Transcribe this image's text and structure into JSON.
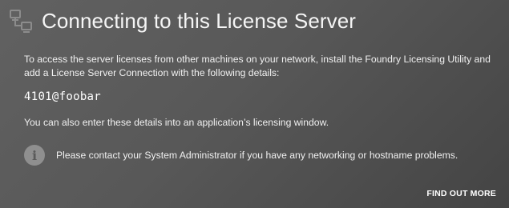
{
  "header": {
    "icon": "network-computers-icon",
    "title": "Connecting to this License Server"
  },
  "body": {
    "intro": "To access the server licenses from other machines on your network, install the Foundry Licensing Utility and add a License Server Connection with the following details:",
    "server_address": "4101@foobar",
    "also_text": "You can also enter these details into an application’s licensing window.",
    "info_icon": "info-icon",
    "info_text": "Please contact your System Administrator if you have any networking or hostname problems."
  },
  "actions": {
    "find_out_more": "FIND OUT MORE"
  },
  "colors": {
    "background": "#585858",
    "text": "#ffffff",
    "icon": "#8f8f8f"
  }
}
